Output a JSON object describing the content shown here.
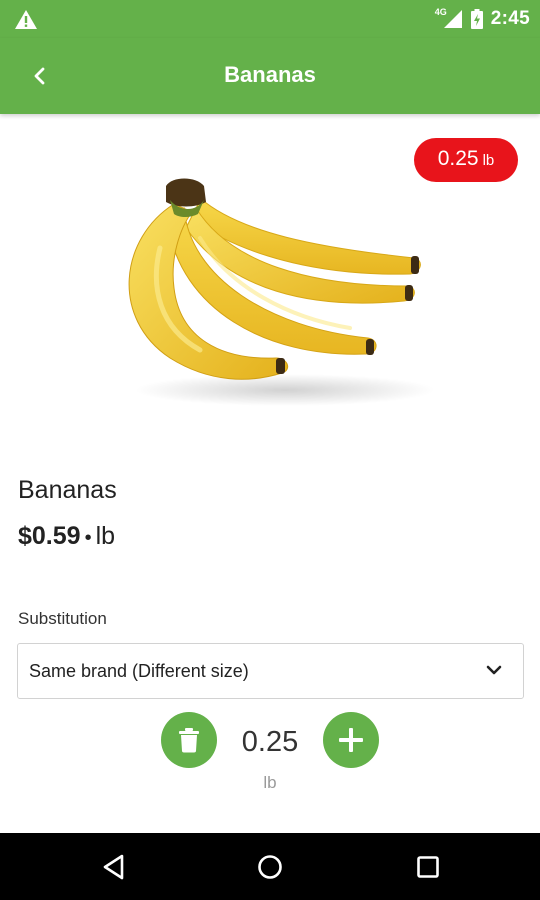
{
  "status_bar": {
    "network": "4G",
    "time": "2:45",
    "icons": [
      "warning-icon",
      "signal-icon",
      "battery-charging-icon"
    ]
  },
  "app_bar": {
    "title": "Bananas",
    "back_icon": "chevron-left-icon"
  },
  "badge": {
    "value": "0.25",
    "unit": "lb"
  },
  "product": {
    "name": "Bananas",
    "price": "$0.59",
    "separator": "•",
    "price_unit": "lb",
    "image_icon": "banana-bunch-image"
  },
  "substitution": {
    "label": "Substitution",
    "selected": "Same brand (Different size)",
    "dropdown_icon": "chevron-down-icon"
  },
  "quantity": {
    "value": "0.25",
    "unit": "lb",
    "delete_icon": "trash-icon",
    "add_icon": "plus-icon"
  },
  "nav_bar": {
    "icons": [
      "nav-back-icon",
      "nav-home-icon",
      "nav-recents-icon"
    ]
  },
  "colors": {
    "primary": "#64b14a",
    "badge": "#e8141b",
    "nav": "#000000"
  }
}
